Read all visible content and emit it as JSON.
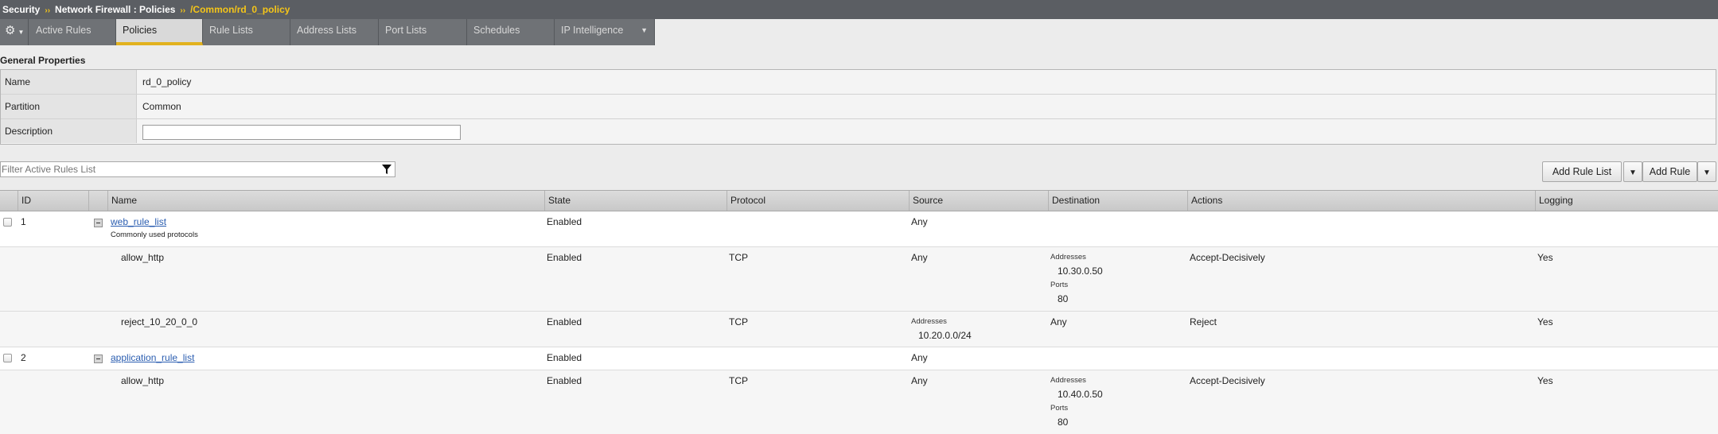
{
  "breadcrumb": {
    "items": [
      "Security",
      "Network Firewall : Policies"
    ],
    "separator": "››",
    "current": "/Common/rd_0_policy"
  },
  "tabs": [
    {
      "label": "Active Rules"
    },
    {
      "label": "Policies"
    },
    {
      "label": "Rule Lists"
    },
    {
      "label": "Address Lists"
    },
    {
      "label": "Port Lists"
    },
    {
      "label": "Schedules"
    },
    {
      "label": "IP Intelligence"
    }
  ],
  "active_tab": "Policies",
  "general": {
    "title": "General Properties",
    "name_label": "Name",
    "name_value": "rd_0_policy",
    "partition_label": "Partition",
    "partition_value": "Common",
    "description_label": "Description",
    "description_value": ""
  },
  "filter": {
    "placeholder": "Filter Active Rules List"
  },
  "buttons": {
    "add_rule_list": "Add Rule List",
    "add_rule": "Add Rule"
  },
  "columns": {
    "id": "ID",
    "name": "Name",
    "state": "State",
    "protocol": "Protocol",
    "source": "Source",
    "destination": "Destination",
    "actions": "Actions",
    "logging": "Logging"
  },
  "labels": {
    "addresses": "Addresses",
    "ports": "Ports"
  },
  "rows": {
    "r1": {
      "id": "1",
      "name": "web_rule_list",
      "desc": "Commonly used protocols",
      "state": "Enabled",
      "source": "Any"
    },
    "r1a": {
      "name": "allow_http",
      "state": "Enabled",
      "protocol": "TCP",
      "source": "Any",
      "dest_address": "10.30.0.50",
      "dest_port": "80",
      "action": "Accept-Decisively",
      "logging": "Yes"
    },
    "r1b": {
      "name": "reject_10_20_0_0",
      "state": "Enabled",
      "protocol": "TCP",
      "src_address": "10.20.0.0/24",
      "destination": "Any",
      "action": "Reject",
      "logging": "Yes"
    },
    "r2": {
      "id": "2",
      "name": "application_rule_list",
      "state": "Enabled",
      "source": "Any"
    },
    "r2a": {
      "name": "allow_http",
      "state": "Enabled",
      "protocol": "TCP",
      "source": "Any",
      "dest_address": "10.40.0.50",
      "dest_port": "80",
      "action": "Accept-Decisively",
      "logging": "Yes"
    }
  },
  "colors": {
    "accent": "#e2b21f",
    "header_bar": "#5b5e63",
    "link": "#2a5db0"
  }
}
